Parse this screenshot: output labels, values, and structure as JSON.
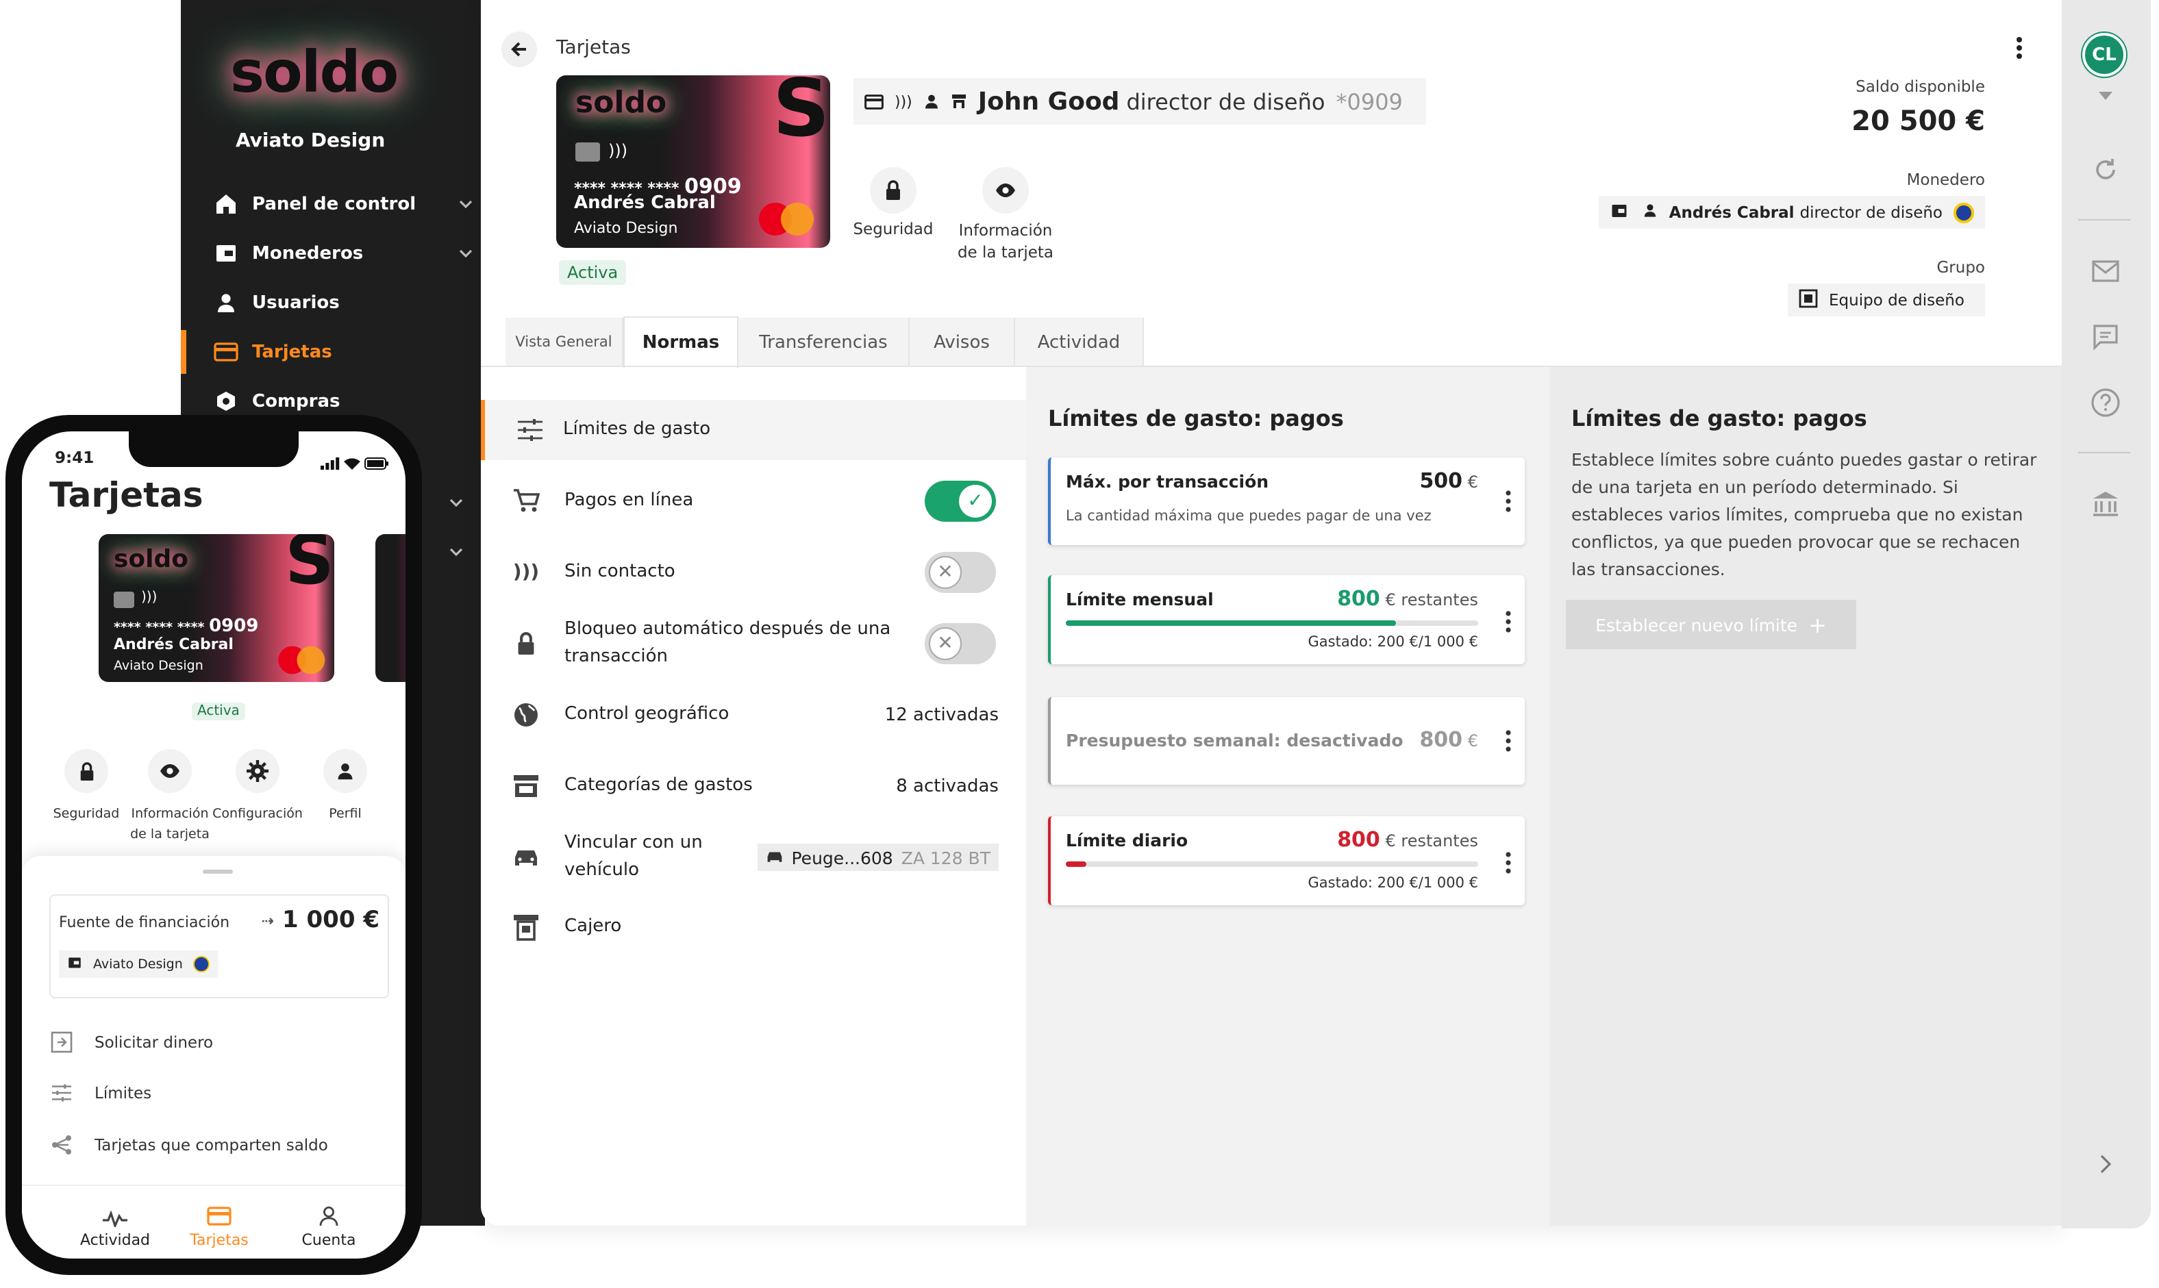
{
  "sidebar": {
    "logo": "soldo",
    "org": "Aviato Design",
    "items": [
      {
        "label": "Panel de control",
        "icon": "home-icon"
      },
      {
        "label": "Monederos",
        "icon": "wallet-icon"
      },
      {
        "label": "Usuarios",
        "icon": "user-icon"
      },
      {
        "label": "Tarjetas",
        "icon": "card-icon"
      },
      {
        "label": "Compras",
        "icon": "purchase-icon"
      }
    ]
  },
  "header": {
    "breadcrumb": "Tarjetas",
    "card_holder": "John Good",
    "card_holder_role": "director de diseño",
    "card_last": "*0909",
    "balance_label": "Saldo disponible",
    "balance": "20 500 €",
    "wallet_label": "Monedero",
    "wallet_holder": "Andrés Cabral",
    "wallet_role": "director de diseño",
    "group_label": "Grupo",
    "group": "Equipo de diseño"
  },
  "card": {
    "logo": "soldo",
    "number": "**** **** ****",
    "last4": "0909",
    "name": "Andrés Cabral",
    "company": "Aviato Design",
    "status": "Activa",
    "actions": [
      {
        "label": "Seguridad"
      },
      {
        "label": "Información de la tarjeta"
      }
    ]
  },
  "tabs": [
    "Vista General",
    "Normas",
    "Transferencias",
    "Avisos",
    "Actividad"
  ],
  "rules": [
    {
      "label": "Límites de gasto"
    },
    {
      "label": "Pagos en línea"
    },
    {
      "label": "Sin contacto"
    },
    {
      "label": "Bloqueo automático después de una transacción"
    },
    {
      "label": "Control geográfico",
      "value": "12 activadas"
    },
    {
      "label": "Categorías de gastos",
      "value": "8 activadas"
    },
    {
      "label": "Vincular con un vehículo",
      "vehicle": "Peuge...608",
      "plate": "ZA 128 BT"
    },
    {
      "label": "Cajero"
    }
  ],
  "limits": {
    "title": "Límites de gasto: pagos",
    "items": [
      {
        "title": "Máx. por transacción",
        "amount": "500",
        "currency": "€",
        "desc": "La cantidad máxima que puedes pagar de una vez",
        "color": "#3b78c9"
      },
      {
        "title": "Límite mensual",
        "amount": "800",
        "currency": "€ restantes",
        "spent": "Gastado: 200 €/1 000 €",
        "progress": 0.8,
        "color": "#1a9c6a"
      },
      {
        "title": "Presupuesto semanal: desactivado",
        "amount": "800",
        "currency": "€",
        "color": "#9a9a9a"
      },
      {
        "title": "Límite diario",
        "amount": "800",
        "currency": "€ restantes",
        "spent": "Gastado: 200 €/1 000 €",
        "progress": 0.05,
        "color": "#d0202f"
      }
    ]
  },
  "help": {
    "title": "Límites de gasto: pagos",
    "text": "Establece límites sobre cuánto puedes gastar o retirar de una tarjeta en un período determinado. Si estableces varios límites, comprueba que no existan conflictos, ya que pueden provocar que se rechacen las transacciones.",
    "button": "Establecer nuevo límite"
  },
  "user": {
    "initials": "CL"
  },
  "phone": {
    "time": "9:41",
    "title": "Tarjetas",
    "card_number": "**** **** ****",
    "card_last4": "0909",
    "card_name": "Andrés Cabral",
    "card_company": "Aviato Design",
    "status": "Activa",
    "actions": [
      {
        "label": "Seguridad"
      },
      {
        "label": "Información de la tarjeta"
      },
      {
        "label": "Configuración"
      },
      {
        "label": "Perfil"
      }
    ],
    "funding_label": "Fuente de financiación",
    "funding_amount": "1 000 €",
    "funding_wallet": "Aviato Design",
    "menu": [
      {
        "label": "Solicitar dinero"
      },
      {
        "label": "Límites"
      },
      {
        "label": "Tarjetas que comparten saldo"
      }
    ],
    "nav": [
      {
        "label": "Actividad"
      },
      {
        "label": "Tarjetas"
      },
      {
        "label": "Cuenta"
      }
    ]
  },
  "colors": {
    "accent": "#ff8a1e",
    "green": "#1aa36a",
    "red": "#d0202f",
    "sidebar": "#1e1e1e"
  }
}
